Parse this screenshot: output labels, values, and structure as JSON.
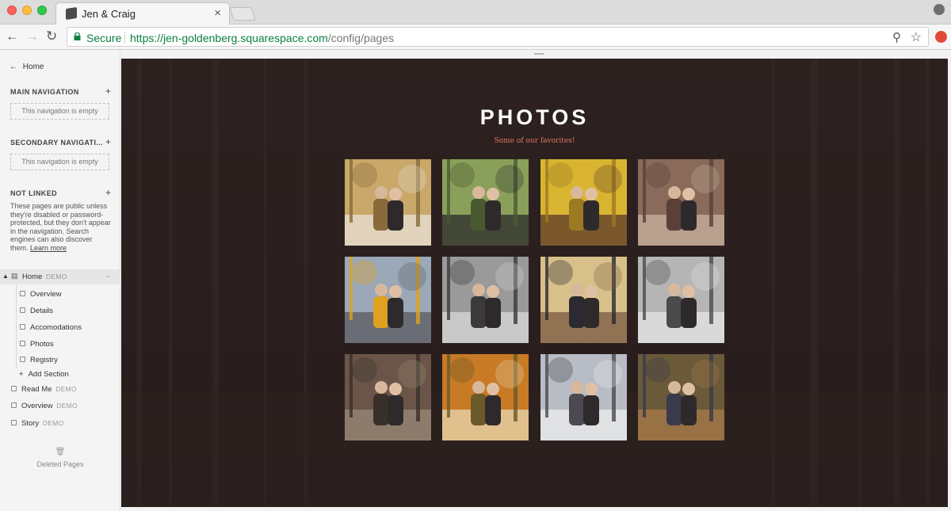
{
  "browser": {
    "tab_title": "Jen & Craig",
    "tab_close": "×",
    "secure_label": "Secure",
    "url_host": "https://jen-goldenberg.squarespace.com",
    "url_path": "/config/pages",
    "icons": [
      "back-arrow-icon",
      "forward-arrow-icon",
      "reload-icon",
      "lock-icon",
      "zoom-icon",
      "star-icon",
      "profile-icon",
      "extension-icon"
    ]
  },
  "sidebar": {
    "home_link": "Home",
    "main_nav_title": "MAIN NAVIGATION",
    "main_nav_empty": "This navigation is empty",
    "secondary_nav_title": "SECONDARY NAVIGATI...",
    "secondary_nav_empty": "This navigation is empty",
    "not_linked_title": "NOT LINKED",
    "not_linked_desc": "These pages are public unless they're disabled or password-protected, but they don't appear in the navigation. Search engines can also discover them.",
    "learn_more": "Learn more",
    "add_symbol": "+",
    "home_page": {
      "label": "Home",
      "badge": "DEMO"
    },
    "subpages": [
      "Overview",
      "Details",
      "Accomodations",
      "Photos",
      "Registry"
    ],
    "add_section": "Add Section",
    "other_pages": [
      {
        "label": "Read Me",
        "badge": "DEMO"
      },
      {
        "label": "Overview",
        "badge": "DEMO"
      },
      {
        "label": "Story",
        "badge": "DEMO"
      }
    ],
    "deleted_pages": "Deleted Pages"
  },
  "main": {
    "title": "PHOTOS",
    "subtitle": "Some of our favorites!",
    "colors": {
      "background": "#271c1b",
      "subtitle": "#e0745f"
    },
    "gallery": [
      {
        "scene": "autumn-park-path",
        "colors": [
          "#c9a86a",
          "#8a6a3a",
          "#e8e2d8"
        ]
      },
      {
        "scene": "couple-closeup-green",
        "colors": [
          "#8aa05a",
          "#4a5a30",
          "#2b2b2b"
        ]
      },
      {
        "scene": "couple-yellow-leaves",
        "colors": [
          "#d9b431",
          "#9c7a22",
          "#5a3a2a"
        ]
      },
      {
        "scene": "brownstone-steps",
        "colors": [
          "#8a6a5a",
          "#5a4036",
          "#c8b2a0"
        ]
      },
      {
        "scene": "taxi-street",
        "colors": [
          "#9aa8b8",
          "#e0a020",
          "#5a5a60"
        ]
      },
      {
        "scene": "bw-street-couple",
        "colors": [
          "#9a9a9a",
          "#3a3a3a",
          "#d8d8d8"
        ]
      },
      {
        "scene": "couple-sunlight",
        "colors": [
          "#d8c08a",
          "#2a2a30",
          "#7a5a40"
        ]
      },
      {
        "scene": "bw-walking",
        "colors": [
          "#b5b5b5",
          "#4a4a4a",
          "#e5e5e5"
        ]
      },
      {
        "scene": "brick-archway",
        "colors": [
          "#6a5548",
          "#3a302a",
          "#9a8a78"
        ]
      },
      {
        "scene": "autumn-canopy",
        "colors": [
          "#c87a24",
          "#6a5a2a",
          "#e8d8b0"
        ]
      },
      {
        "scene": "winter-park-walk",
        "colors": [
          "#b8bcc4",
          "#4a4a50",
          "#eeeeee"
        ]
      },
      {
        "scene": "couple-stone-wall",
        "colors": [
          "#6a5a3a",
          "#3a3a4a",
          "#a87a4a"
        ]
      }
    ]
  }
}
